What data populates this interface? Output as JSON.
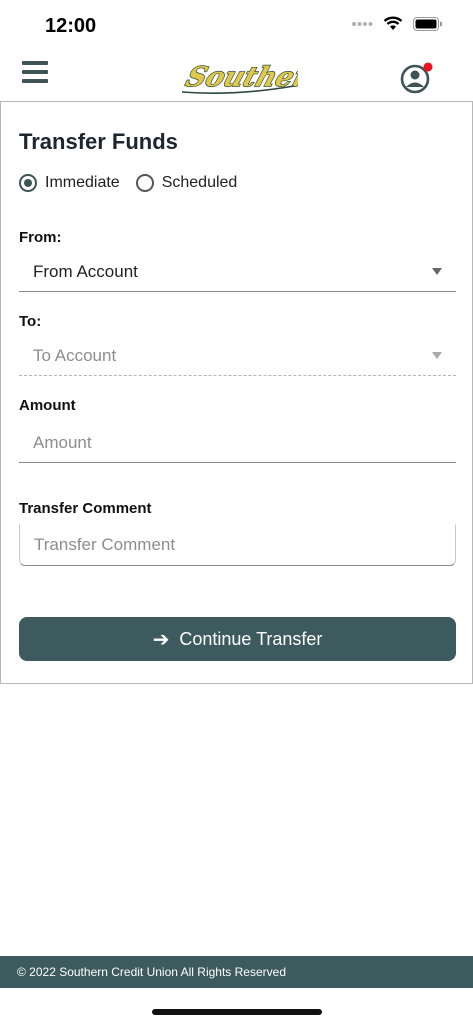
{
  "status_bar": {
    "time": "12:00"
  },
  "header": {
    "logo_text": "Southern",
    "colors": {
      "accent": "#3d5a5e",
      "logo_gold": "#e0c84a",
      "logo_green": "#2f4a3a",
      "notification": "#e8131d"
    }
  },
  "form": {
    "title": "Transfer Funds",
    "transfer_type": {
      "options": [
        "Immediate",
        "Scheduled"
      ],
      "selected": "Immediate"
    },
    "from": {
      "label": "From:",
      "value": "From Account"
    },
    "to": {
      "label": "To:",
      "value": "To Account"
    },
    "amount": {
      "label": "Amount",
      "placeholder": "Amount"
    },
    "comment": {
      "label": "Transfer Comment",
      "placeholder": "Transfer Comment"
    },
    "continue_label": "Continue Transfer"
  },
  "footer": {
    "text": "© 2022 Southern Credit Union All Rights Reserved"
  }
}
